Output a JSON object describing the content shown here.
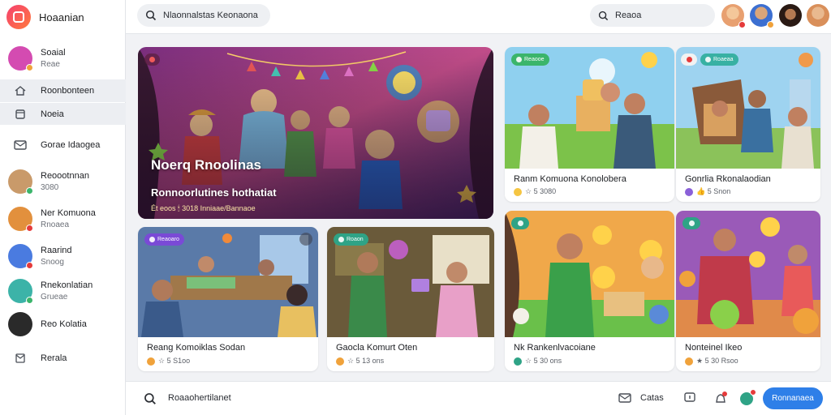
{
  "app": {
    "name": "Hoaanian",
    "brand_color": "#f5406f"
  },
  "sidebar": {
    "items": [
      {
        "title": "Soaial",
        "sub": "Reae",
        "avatar_color": "#d44bb1",
        "dot_color": "#f0a23b"
      },
      {
        "title": "Roonbonteen",
        "icon": "home-icon"
      },
      {
        "title": "Noeia",
        "icon": "bookmark-icon"
      },
      {
        "title": "Gorae Idaogea",
        "icon": "mail-icon"
      },
      {
        "title": "Reoootnnan",
        "sub": "3080",
        "avatar_color": "#c99a6a",
        "dot_color": "#3bb56b"
      },
      {
        "title": "Ner Komuona",
        "sub": "Rnoaea",
        "avatar_color": "#e2903d",
        "dot_color": "#e53b3b"
      },
      {
        "title": "Raarind",
        "sub": "Snoog",
        "avatar_color": "#4a7be0",
        "dot_color": "#e53b3b"
      },
      {
        "title": "Rnekonlatian",
        "sub": "Grueae",
        "avatar_color": "#3cb3a8",
        "dot_color": "#3bb56b"
      },
      {
        "title": "Reo Kolatia",
        "avatar_color": "#2a2a2a"
      },
      {
        "title": "Rerala",
        "icon": "inbox-icon"
      }
    ]
  },
  "topbar": {
    "search_text": "Nlaonnalstas Keonaona",
    "search2_text": "Reaoa",
    "avatars": [
      {
        "color": "#e8a070"
      },
      {
        "color": "#3c6fd1"
      },
      {
        "color": "#5c3a2a"
      },
      {
        "color": "#d98f5a"
      }
    ]
  },
  "feature": {
    "title": "Noerq Rnoolinas",
    "subtitle": "Ronnoorlutines hothatiat",
    "meta": "Ét eoos  🕯 3018 Inniaae/Bannaoe"
  },
  "cards": [
    {
      "title": "Ranm Komuona Konolobera",
      "meta": "☆ 5 3080",
      "badge": "Reaooe",
      "badge_color": "#3bb56b",
      "img": "a"
    },
    {
      "title": "Gonrlia Rkonalaodian",
      "meta": "👍 5 Snon",
      "badge": "Roaeaa",
      "badge_color": "#38b1a3",
      "img": "b"
    },
    {
      "title": "Reang Komoiklas Sodan",
      "meta": "☆ 5 S1oo",
      "badge": "Reaoaro",
      "badge_color": "#7a4ad6",
      "img": "c"
    },
    {
      "title": "Gaocla Komurt Oten",
      "meta": "☆ 5 13 ons",
      "badge": "Roaon",
      "badge_color": "#2fa386",
      "img": "d"
    },
    {
      "title": "Nk Rankenlvacoiane",
      "meta": "☆ 5 30 ons",
      "badge": "",
      "badge_color": "#2fa386",
      "img": "e"
    },
    {
      "title": "Nonteinel Ikeo",
      "meta": "★ 5 30 Rsoo",
      "badge": "",
      "badge_color": "#2fa386",
      "img": "f"
    }
  ],
  "bottombar": {
    "composer_text": "Roaaohertilanet",
    "label": "Catas",
    "button_label": "Ronnanaea",
    "button_color": "#2e7fe8"
  }
}
